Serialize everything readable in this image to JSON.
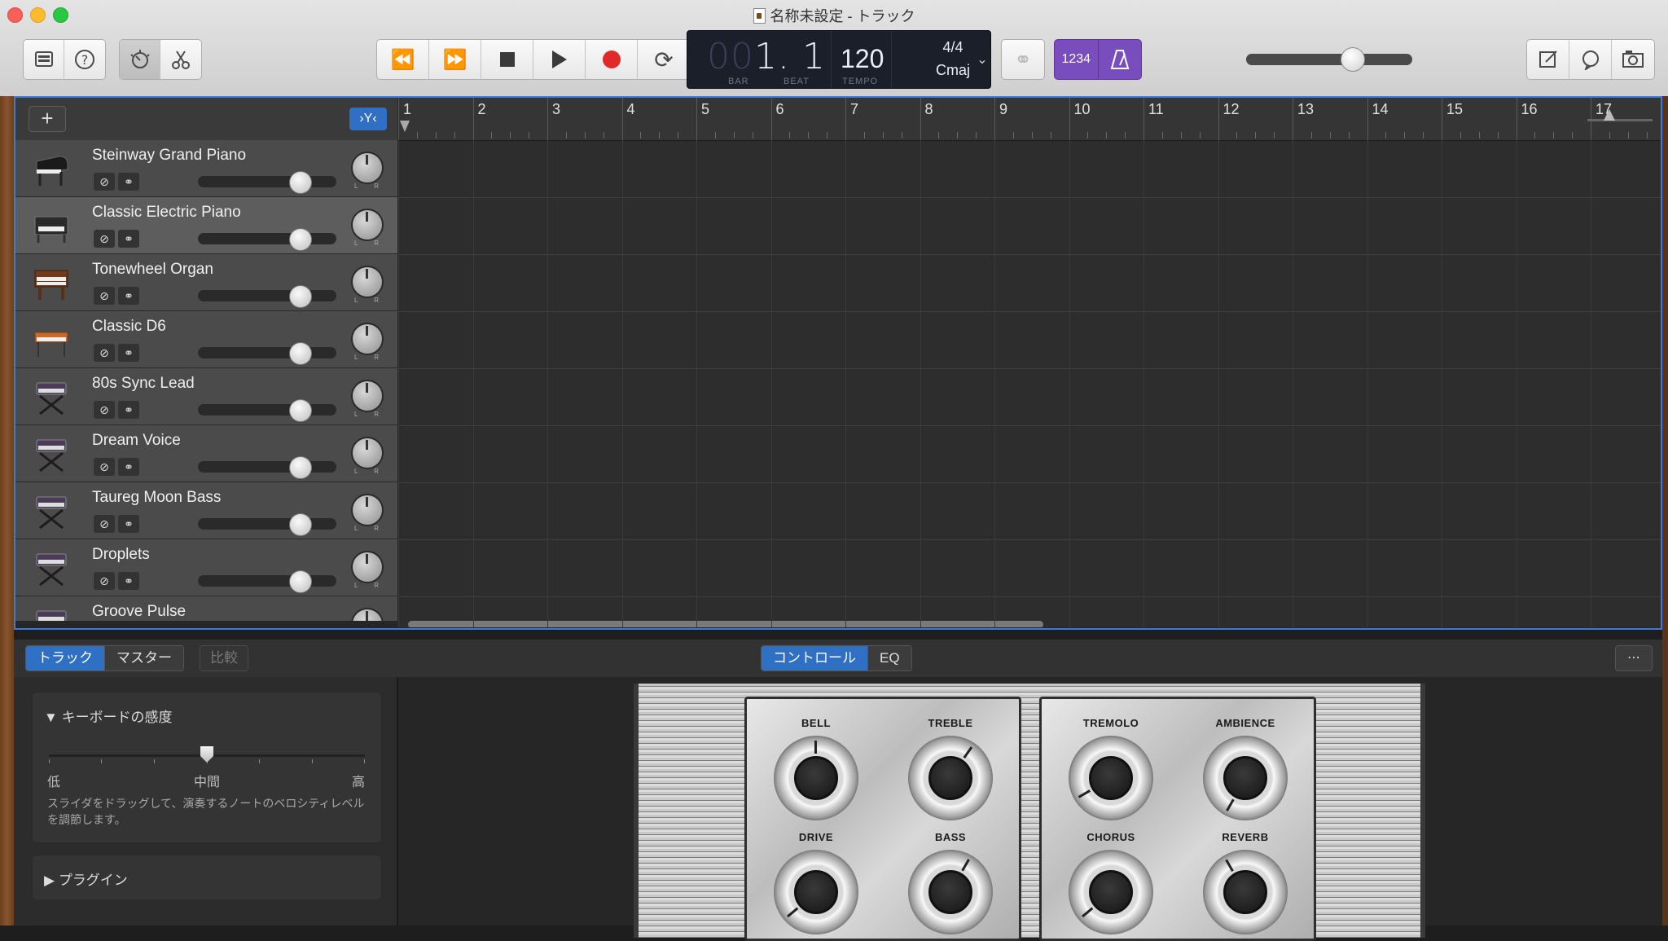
{
  "window": {
    "title": "名称未設定 - トラック"
  },
  "toolbar": {
    "left_buttons": [
      "library-icon",
      "help-icon"
    ],
    "mode_buttons": [
      "smart-controls-icon",
      "scissors-icon"
    ],
    "transport": [
      "rewind-icon",
      "fast-forward-icon",
      "stop-icon",
      "play-icon",
      "record-icon",
      "cycle-icon"
    ],
    "right_buttons": [
      "notepad-icon",
      "loop-browser-icon",
      "media-browser-icon"
    ]
  },
  "lcd": {
    "position_dim": "00",
    "position": "1. 1",
    "bar_label": "BAR",
    "beat_label": "BEAT",
    "tempo": "120",
    "tempo_label": "TEMPO",
    "time_signature": "4/4",
    "key": "Cmaj"
  },
  "count_in": {
    "label": "1234"
  },
  "master_volume": {
    "level": 0.66
  },
  "tracks": [
    {
      "name": "Steinway Grand Piano",
      "icon": "grand-piano-icon"
    },
    {
      "name": "Classic Electric Piano",
      "icon": "electric-piano-icon",
      "selected": true
    },
    {
      "name": "Tonewheel Organ",
      "icon": "organ-icon"
    },
    {
      "name": "Classic D6",
      "icon": "clavinet-icon"
    },
    {
      "name": "80s Sync Lead",
      "icon": "synth-stand-icon"
    },
    {
      "name": "Dream Voice",
      "icon": "synth-stand-icon"
    },
    {
      "name": "Taureg Moon Bass",
      "icon": "synth-stand-icon"
    },
    {
      "name": "Droplets",
      "icon": "synth-stand-icon"
    },
    {
      "name": "Groove Pulse",
      "icon": "synth-stand-icon"
    }
  ],
  "track_pan_labels": {
    "left": "L",
    "right": "R"
  },
  "ruler": {
    "bars": [
      "1",
      "2",
      "3",
      "4",
      "5",
      "6",
      "7",
      "8",
      "9",
      "10",
      "11",
      "12",
      "13",
      "14",
      "15",
      "16",
      "17"
    ]
  },
  "bottom": {
    "tabs": [
      "トラック",
      "マスター"
    ],
    "compare": "比較",
    "view_tabs": [
      "コントロール",
      "EQ"
    ],
    "keyboard_sensitivity_title": "キーボードの感度",
    "sens_low": "低",
    "sens_mid": "中間",
    "sens_high": "高",
    "sens_level": 0.5,
    "sens_desc": "スライダをドラッグして、演奏するノートのベロシティレベルを調節します。",
    "plugins_title": "プラグイン"
  },
  "amp_knobs": {
    "panel1": [
      {
        "label": "BELL",
        "angle": 0
      },
      {
        "label": "TREBLE",
        "angle": 35
      },
      {
        "label": "DRIVE",
        "angle": -130
      },
      {
        "label": "BASS",
        "angle": 30
      }
    ],
    "panel2": [
      {
        "label": "TREMOLO",
        "angle": -120
      },
      {
        "label": "AMBIENCE",
        "angle": -150
      },
      {
        "label": "CHORUS",
        "angle": -130
      },
      {
        "label": "REVERB",
        "angle": -30
      }
    ]
  },
  "colors": {
    "accent_blue": "#2f6fc4",
    "count_in_purple": "#7a4dbf",
    "record_red": "#e02a2a"
  }
}
